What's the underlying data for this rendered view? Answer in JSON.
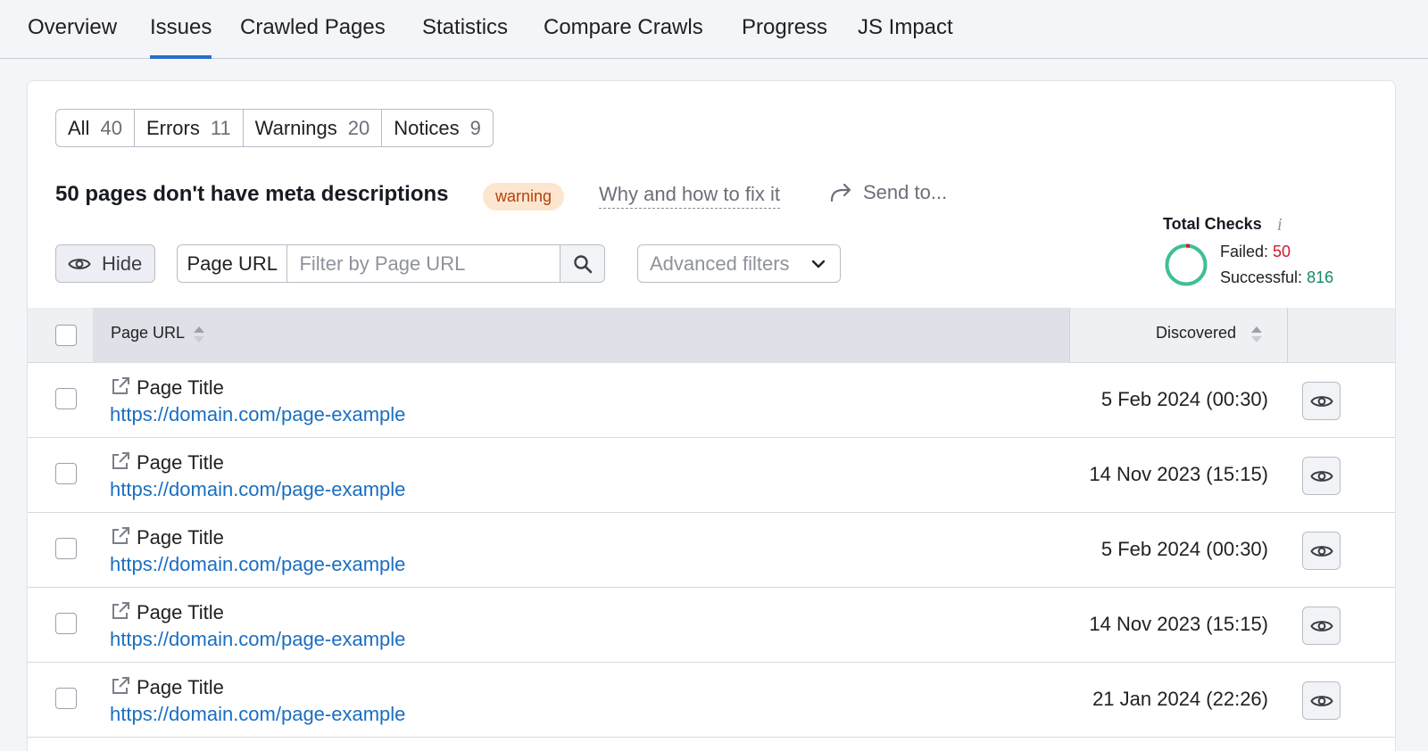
{
  "tabs": [
    {
      "label": "Overview",
      "active": false
    },
    {
      "label": "Issues",
      "active": true
    },
    {
      "label": "Crawled Pages",
      "active": false
    },
    {
      "label": "Statistics",
      "active": false
    },
    {
      "label": "Compare Crawls",
      "active": false
    },
    {
      "label": "Progress",
      "active": false
    },
    {
      "label": "JS Impact",
      "active": false
    }
  ],
  "filters": [
    {
      "label": "All",
      "count": "40"
    },
    {
      "label": "Errors",
      "count": "11"
    },
    {
      "label": "Warnings",
      "count": "20"
    },
    {
      "label": "Notices",
      "count": "9"
    }
  ],
  "issue": {
    "title": "50 pages don't have meta descriptions",
    "badge": "warning",
    "why_link": "Why and how to fix it",
    "send_to": "Send to..."
  },
  "toolbar": {
    "hide_label": "Hide",
    "search_label": "Page URL",
    "search_placeholder": "Filter by Page URL",
    "advanced_filters": "Advanced filters"
  },
  "total_checks": {
    "title": "Total Checks",
    "info": "i",
    "failed_label": "Failed:",
    "failed_value": "50",
    "successful_label": "Successful:",
    "successful_value": "816",
    "failed_color": "#d3172b",
    "successful_color": "#3fbf93"
  },
  "table": {
    "columns": {
      "url": "Page URL",
      "discovered": "Discovered"
    },
    "rows": [
      {
        "title": "Page Title",
        "url": "https://domain.com/page-example",
        "discovered": "5 Feb 2024 (00:30)"
      },
      {
        "title": "Page Title",
        "url": "https://domain.com/page-example",
        "discovered": "14 Nov 2023 (15:15)"
      },
      {
        "title": "Page Title",
        "url": "https://domain.com/page-example",
        "discovered": "5 Feb 2024 (00:30)"
      },
      {
        "title": "Page Title",
        "url": "https://domain.com/page-example",
        "discovered": "14 Nov 2023 (15:15)"
      },
      {
        "title": "Page Title",
        "url": "https://domain.com/page-example",
        "discovered": "21 Jan 2024 (22:26)"
      }
    ]
  },
  "colors": {
    "accent": "#2a6fc9",
    "link": "#1a6ec1",
    "badge_bg": "#fde6cf",
    "badge_text": "#b5410e"
  }
}
